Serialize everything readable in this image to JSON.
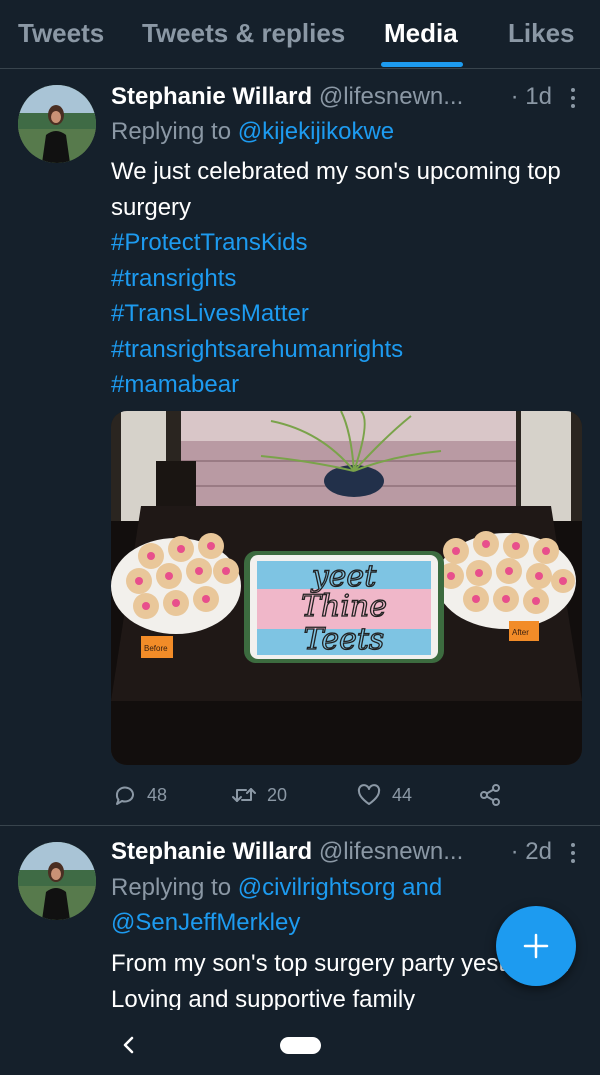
{
  "tabs": [
    {
      "label": "Tweets",
      "active": false
    },
    {
      "label": "Tweets & replies",
      "active": false
    },
    {
      "label": "Media",
      "active": true
    },
    {
      "label": "Likes",
      "active": false
    }
  ],
  "tweets": [
    {
      "name": "Stephanie Willard",
      "handle": "@lifesnewn...",
      "time": "· 1d",
      "replying_prefix": "Replying to",
      "replying_to": "@kijekijikokwe",
      "replying_joiner": "",
      "replying_to_2": "",
      "text": "We just celebrated my son's upcoming top surgery",
      "hashtags": [
        "#ProtectTransKids",
        "#transrights",
        "#TransLivesMatter",
        "#transrightsarehumanrights",
        "#mamabear"
      ],
      "media": {
        "cake_text": [
          "yeet",
          "Thine",
          "Teets"
        ],
        "label_left": "Before",
        "label_right": "After"
      },
      "stats": {
        "replies": "48",
        "retweets": "20",
        "likes": "44"
      }
    },
    {
      "name": "Stephanie Willard",
      "handle": "@lifesnewn...",
      "time": "· 2d",
      "replying_prefix": "Replying to",
      "replying_to": "@civilrightsorg",
      "replying_joiner": "and",
      "replying_to_2": "@SenJeffMerkley",
      "text": "From my son's top surgery party yesterday. Loving and supportive family"
    }
  ],
  "icons": {
    "reply": "speech-bubble-icon",
    "retweet": "retweet-icon",
    "like": "heart-icon",
    "share": "share-icon",
    "compose": "plus-icon",
    "more": "vertical-dots-icon"
  },
  "colors": {
    "background": "#15202b",
    "accent": "#1d9bf0",
    "muted": "#8b98a5",
    "border": "#38444d"
  }
}
